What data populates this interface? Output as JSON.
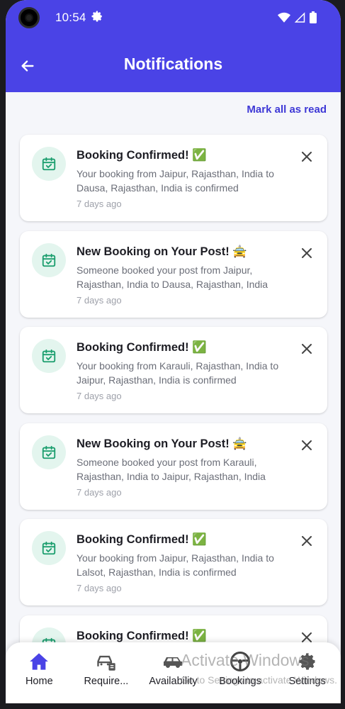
{
  "status_bar": {
    "time": "10:54"
  },
  "app_bar": {
    "title": "Notifications"
  },
  "actions": {
    "mark_all_read": "Mark all as read"
  },
  "notifications": [
    {
      "title": "Booking Confirmed! ✅",
      "body": "Your booking from Jaipur, Rajasthan, India to Dausa, Rajasthan, India is confirmed",
      "time": "7 days ago"
    },
    {
      "title": "New Booking on Your Post! 🚖",
      "body": "Someone booked your post from Jaipur, Rajasthan, India to Dausa, Rajasthan, India",
      "time": "7 days ago"
    },
    {
      "title": "Booking Confirmed! ✅",
      "body": "Your booking from Karauli, Rajasthan, India to Jaipur, Rajasthan, India is confirmed",
      "time": "7 days ago"
    },
    {
      "title": "New Booking on Your Post! 🚖",
      "body": "Someone booked your post from Karauli, Rajasthan, India to Jaipur, Rajasthan, India",
      "time": "7 days ago"
    },
    {
      "title": "Booking Confirmed! ✅",
      "body": "Your booking from Jaipur, Rajasthan, India to Lalsot, Rajasthan, India is confirmed",
      "time": "7 days ago"
    },
    {
      "title": "Booking Confirmed! ✅",
      "body": "",
      "time": ""
    }
  ],
  "bottom_nav": [
    {
      "label": "Home",
      "icon": "home-icon",
      "active": true
    },
    {
      "label": "Require...",
      "icon": "car-request-icon",
      "active": false
    },
    {
      "label": "Availability",
      "icon": "car-icon",
      "active": false
    },
    {
      "label": "Bookings",
      "icon": "steering-wheel-icon",
      "active": false
    },
    {
      "label": "Settings",
      "icon": "gear-icon",
      "active": false
    }
  ],
  "overlay": {
    "watermark_line1": "Activate Windows",
    "watermark_line2": "Go to Settings to activate Windows."
  },
  "colors": {
    "primary": "#4a43e6",
    "accent_green": "#1b9e6e",
    "background": "#f5f6fa"
  }
}
